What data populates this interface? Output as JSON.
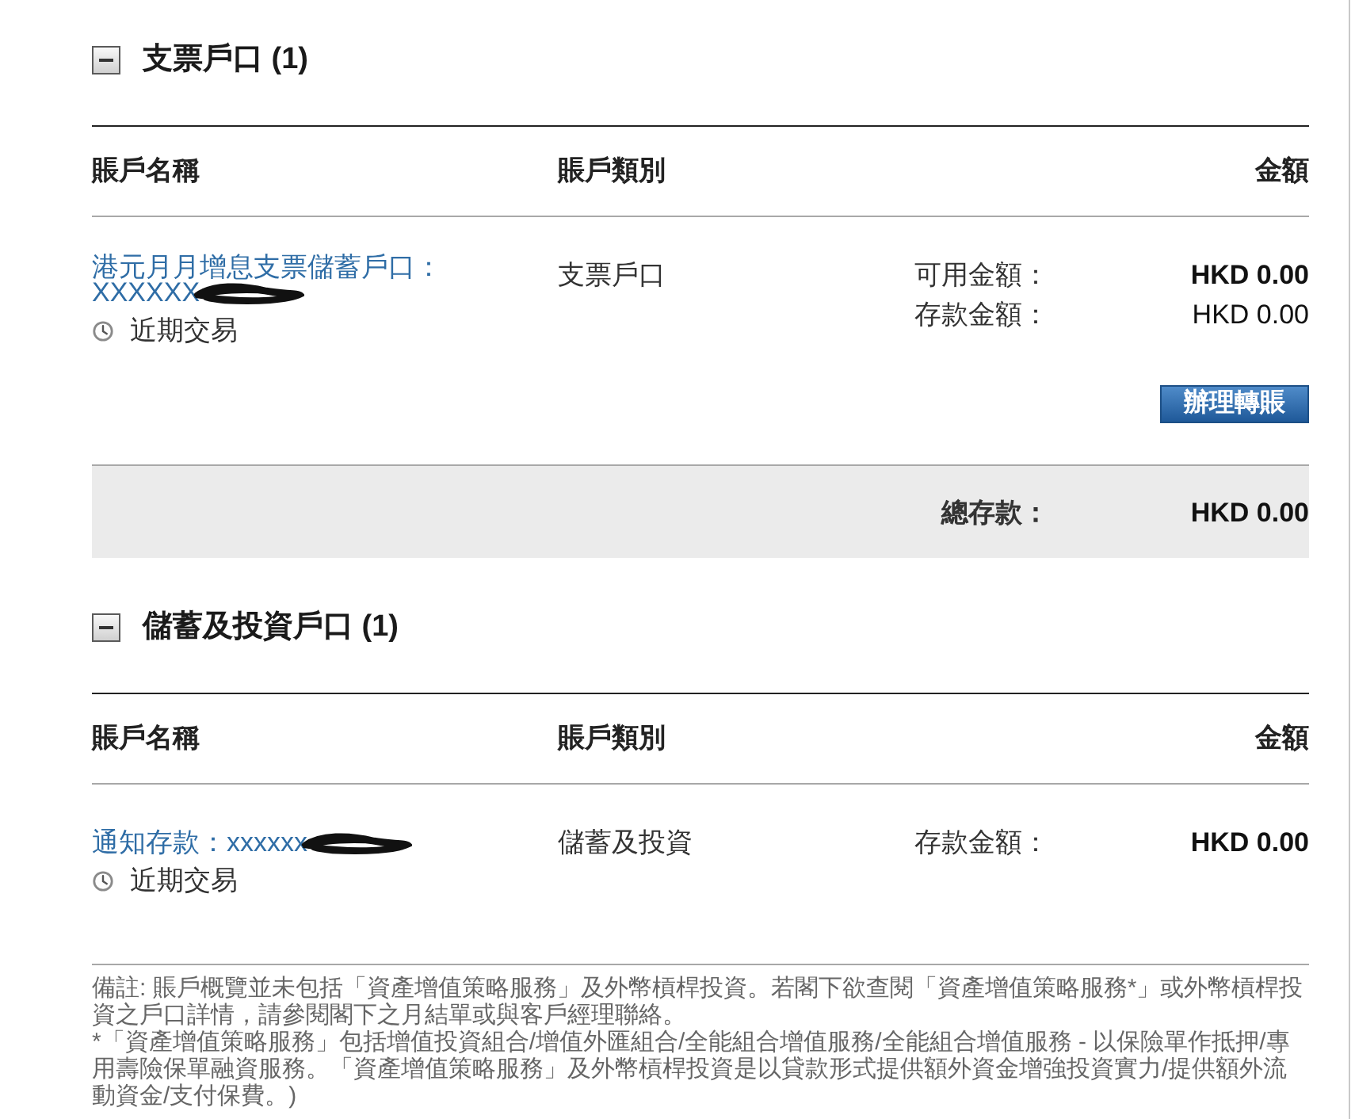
{
  "sections": [
    {
      "title": "支票戶口 (1)",
      "expanded": true,
      "columns": [
        "賬戶名稱",
        "賬戶類別",
        "金額"
      ],
      "accounts": [
        {
          "name": "港元月月增息支票儲蓄戶口：XXXXXX",
          "redacted": true,
          "recent_link": "近期交易",
          "type": "支票戶口",
          "amounts": [
            {
              "label": "可用金額：",
              "value": "HKD 0.00",
              "bold": true
            },
            {
              "label": "存款金額：",
              "value": "HKD 0.00",
              "bold": false
            }
          ],
          "actions": [
            "辦理轉賬"
          ]
        }
      ],
      "total": {
        "label": "總存款：",
        "value": "HKD 0.00"
      }
    },
    {
      "title": "儲蓄及投資戶口 (1)",
      "expanded": true,
      "columns": [
        "賬戶名稱",
        "賬戶類別",
        "金額"
      ],
      "accounts": [
        {
          "name": "通知存款：xxxxxx",
          "redacted": true,
          "recent_link": "近期交易",
          "type": "儲蓄及投資",
          "amounts": [
            {
              "label": "存款金額：",
              "value": "HKD 0.00",
              "bold": true
            }
          ]
        }
      ]
    }
  ],
  "note": [
    "備註: 賬戶概覽並未包括「資產增值策略服務」及外幣槓桿投資。若閣下欲查閱「資產增值策略服務*」或外幣槓桿投資之戶口詳情，請參閱閣下之月結單或與客戶經理聯絡。",
    "*「資產增值策略服務」包括增值投資組合/增值外匯組合/全能組合增值服務/全能組合增值服務 - 以保險單作抵押/專用壽險保單融資服務。「資產增值策略服務」及外幣槓桿投資是以貸款形式提供額外資金增強投資實力/提供額外流動資金/支付保費。)"
  ]
}
